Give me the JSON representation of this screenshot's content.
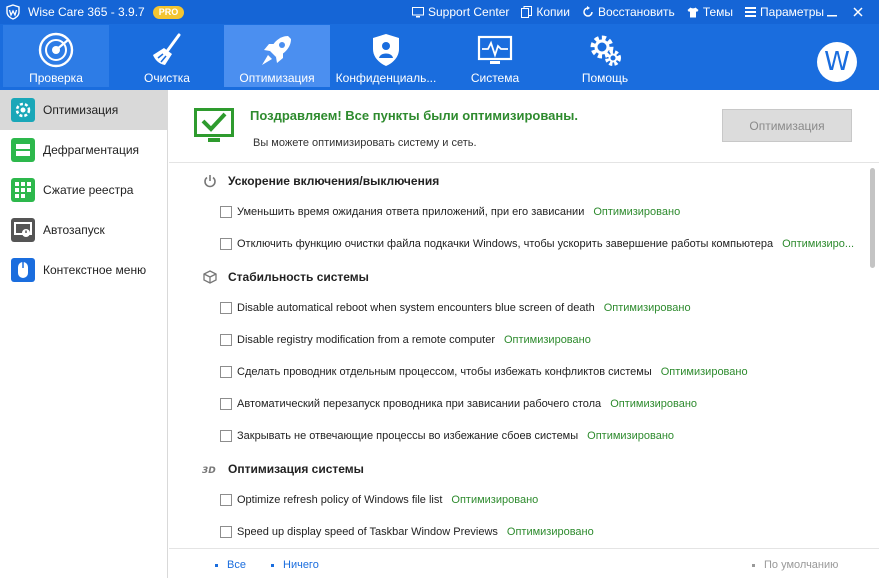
{
  "window": {
    "title": "Wise Care 365 - 3.9.7",
    "badge": "PRO",
    "links": [
      {
        "label": "Support Center",
        "icon": "monitor-icon"
      },
      {
        "label": "Копии",
        "icon": "copy-icon"
      },
      {
        "label": "Восстановить",
        "icon": "restore-icon"
      },
      {
        "label": "Темы",
        "icon": "shirt-icon"
      },
      {
        "label": "Параметры",
        "icon": "menu-icon"
      }
    ]
  },
  "nav": {
    "tabs": [
      {
        "label": "Проверка",
        "icon": "radar-icon"
      },
      {
        "label": "Очистка",
        "icon": "broom-icon"
      },
      {
        "label": "Оптимизация",
        "icon": "rocket-icon",
        "active": true
      },
      {
        "label": "Конфиденциаль...",
        "icon": "shield-person-icon"
      },
      {
        "label": "Система",
        "icon": "monitor-pulse-icon"
      },
      {
        "label": "Помощь",
        "icon": "gears-icon"
      }
    ],
    "avatar_letter": "W"
  },
  "sidebar": {
    "items": [
      {
        "label": "Оптимизация",
        "icon": "optimize-icon",
        "active": true
      },
      {
        "label": "Дефрагментация",
        "icon": "disk-icon"
      },
      {
        "label": "Сжатие реестра",
        "icon": "registry-icon"
      },
      {
        "label": "Автозапуск",
        "icon": "startup-icon"
      },
      {
        "label": "Контекстное меню",
        "icon": "mouse-icon"
      }
    ]
  },
  "banner": {
    "heading": "Поздравляем! Все пункты были оптимизированы.",
    "subtext": "Вы можете оптимизировать систему и сеть.",
    "button": "Оптимизация"
  },
  "sections": [
    {
      "title": "Ускорение включения/выключения",
      "icon": "power-icon",
      "items": [
        {
          "text": "Уменьшить время ожидания ответа приложений, при его зависании",
          "status": "Оптимизировано"
        },
        {
          "text": "Отключить функцию очистки файла подкачки Windows, чтобы ускорить завершение работы компьютера",
          "status": "Оптимизиро..."
        }
      ]
    },
    {
      "title": "Стабильность системы",
      "icon": "cube-icon",
      "items": [
        {
          "text": "Disable automatical reboot when system encounters blue screen of death",
          "status": "Оптимизировано"
        },
        {
          "text": "Disable registry modification from a remote computer",
          "status": "Оптимизировано"
        },
        {
          "text": "Сделать проводник отдельным процессом, чтобы избежать конфликтов системы",
          "status": "Оптимизировано"
        },
        {
          "text": "Автоматический перезапуск проводника при зависании рабочего стола",
          "status": "Оптимизировано"
        },
        {
          "text": "Закрывать не отвечающие процессы во избежание сбоев системы",
          "status": "Оптимизировано"
        }
      ]
    },
    {
      "title": "Оптимизация системы",
      "icon": "3d-icon",
      "items": [
        {
          "text": "Optimize refresh policy of Windows file list",
          "status": "Оптимизировано"
        },
        {
          "text": "Speed up display speed of Taskbar Window Previews",
          "status": "Оптимизировано"
        }
      ]
    }
  ],
  "footer": {
    "all": "Все",
    "none": "Ничего",
    "default": "По умолчанию"
  },
  "colors": {
    "titlebar": "#1565d6",
    "toolbar": "#1a6dde",
    "active_tab": "#4b8ff0",
    "optimized_green": "#2e8b2e"
  }
}
